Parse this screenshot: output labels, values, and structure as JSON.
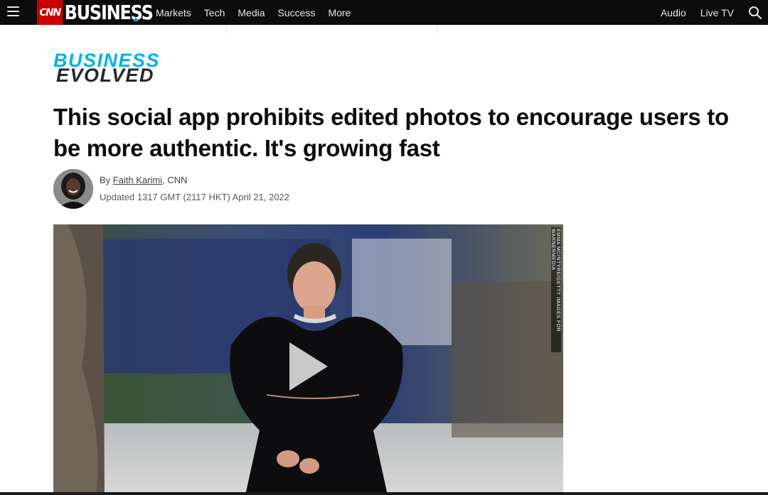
{
  "nav": {
    "brand_cnn": "CNN",
    "brand_business": "BUSINESS",
    "links": [
      "Markets",
      "Tech",
      "Media",
      "Success",
      "More"
    ],
    "right_links": [
      "Audio",
      "Live TV"
    ]
  },
  "section_logo": {
    "line1": "BUSINESS",
    "line2": "EVOLVED"
  },
  "article": {
    "headline": "This social app prohibits edited photos to encourage users to be more authentic. It's growing fast",
    "byline_prefix": "By ",
    "author": "Faith Karimi",
    "byline_suffix": ", CNN",
    "updated": "Updated 1317 GMT (2117 HKT) April 21, 2022"
  },
  "video": {
    "credit": "EMMA MCINTYRE/GETTY IMAGES FOR WARNERMEDIA"
  },
  "colors": {
    "nav_bg": "#0c0c0c",
    "cnn_red": "#cc0000",
    "section_accent": "#00b3e3"
  }
}
